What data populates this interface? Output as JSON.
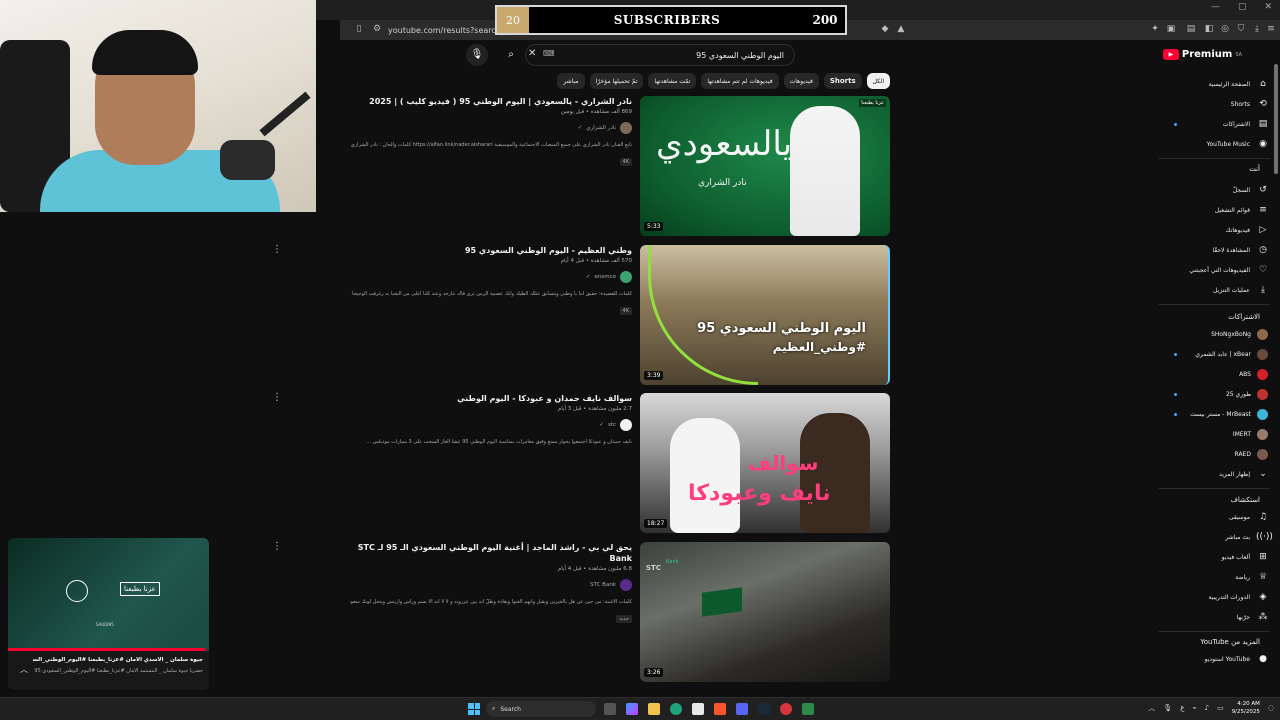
{
  "browser": {
    "url": "youtube.com/results?search_query=اليوم+الوطني+السعودي+95"
  },
  "overlay": {
    "current": "20",
    "title": "SUBSCRIBERS",
    "goal": "200"
  },
  "search": {
    "query": "اليوم الوطني السعودي 95"
  },
  "chips": [
    {
      "label": "الكل",
      "active": true
    },
    {
      "label": "Shorts",
      "active": false
    },
    {
      "label": "فيديوهات",
      "active": false
    },
    {
      "label": "فيديوهات لم تتم مشاهدتها",
      "active": false
    },
    {
      "label": "تمّت مشاهدتها",
      "active": false
    },
    {
      "label": "تمّ تحميلها مؤخرًا",
      "active": false
    },
    {
      "label": "مباشر",
      "active": false
    }
  ],
  "results": [
    {
      "title": "نادر الشراري - يالسعودي | اليوم الوطني 95 ( فيديو كليب ) | 2025",
      "meta": "869 ألف مشاهدة • قبل يومين",
      "channel": "نادر الشراري",
      "desc": "تابع الفنان نادر الشراري على جميع المنصات الاجتماعية والموسيقية https://alfan.link/nader.alsharari كلمات والحان : نادر الشراري ...",
      "badge": "4K",
      "duration": "5:33",
      "thumb_big": "يالسعودي",
      "thumb_small": "نادر الشراري",
      "thumb_tag": "عزنا بطبعنا"
    },
    {
      "title": "وطني العظيم - اليوم الوطني السعودي 95",
      "meta": "570 ألف مشاهدة • قبل 4 أيام",
      "channel": "ensmco",
      "desc": "كلمات للقصيدة: حقيق أننا يا وطني ويتسابق عثلك الطيك وأنك عصبية الزمن ترى فاك تتأرجد وعند كلنا أعلى من النجيا به رغرفت الوجيحا واضحا أصدحه ...",
      "badge": "4K",
      "duration": "3:39",
      "thumb_cap1": "اليوم الوطني السعودي 95",
      "thumb_cap2": "#وطني_العظيم"
    },
    {
      "title": "سوالف نايف حمدان و عبودكا - اليوم الوطني",
      "meta": "2.7 مليون مشاهدة • قبل 3 أيام",
      "channel": "stc",
      "desc": "نايف حمدان و عبودكا اجتمعوا بحوار ممتع وفيق مغامرات بمناسبة اليوم الوطني 95 عشا الغاز السحب على 3 سيارات موديلس ...",
      "badge": "",
      "duration": "18:27",
      "thumb_cap1": "سوالف",
      "thumb_cap2": "نايف وعبودكا"
    },
    {
      "title": "يحق لي بي - راشد الماجد | أغنية اليوم الوطني السعودي الـ 95 لـ STC Bank",
      "meta": "6.8 مليون مشاهدة • قبل 4 أيام",
      "channel": "STC Bank",
      "desc": "كلمات الأغنية: من حين عن هل بالخيرين ويقبل وأنهم الغنوا ويقادة وطلّ انه بين عزرونه و لا لا انه الا بسم وراس وارينس وينحل لونك سعودي الله الغنيا ...",
      "badge": "جديد",
      "duration": "3:26",
      "thumb_logo": "STC",
      "thumb_logo2": "Bank"
    }
  ],
  "sidebar": {
    "logo_word": "Premium",
    "logo_cc": "SA",
    "main": [
      {
        "label": "الصفحة الرئيسية",
        "icon": "⌂"
      },
      {
        "label": "Shorts",
        "icon": "⟲"
      },
      {
        "label": "الاشتراكات",
        "icon": "▤",
        "dot": true
      },
      {
        "label": "YouTube Music",
        "icon": "◉"
      }
    ],
    "you_header": "أنت",
    "you": [
      {
        "label": "السجلّ",
        "icon": "↺"
      },
      {
        "label": "قوائم التشغيل",
        "icon": "≡"
      },
      {
        "label": "فيديوهاتك",
        "icon": "▷"
      },
      {
        "label": "المشاهدة لاحقًا",
        "icon": "◷"
      },
      {
        "label": "الفيديوهات التي أعجبتني",
        "icon": "♡"
      },
      {
        "label": "عمليات التنزيل",
        "icon": "⤓"
      }
    ],
    "subs_header": "الاشتراكات",
    "subs": [
      {
        "label": "SHoNgxBoNg",
        "color": "#8a6a4a"
      },
      {
        "label": "xBear | عابد الشمري",
        "color": "#6a4a3a",
        "dot": true
      },
      {
        "label": "ABS",
        "color": "#d4202a"
      },
      {
        "label": "طوري 25",
        "color": "#b33",
        "dot": true
      },
      {
        "label": "MrBeast - مستر بيست",
        "color": "#3db4d8",
        "dot": true
      },
      {
        "label": "IMERT",
        "color": "#9a7a6a"
      },
      {
        "label": "RAED",
        "color": "#7a5a4a"
      }
    ],
    "show_more": "إظهار المزيد",
    "explore_header": "استكشاف",
    "explore": [
      {
        "label": "موسيقى",
        "icon": "♫"
      },
      {
        "label": "بث مباشر",
        "icon": "((·))"
      },
      {
        "label": "ألعاب فيديو",
        "icon": "⊞"
      },
      {
        "label": "رياضة",
        "icon": "♕"
      },
      {
        "label": "الدورات التدريبية",
        "icon": "◈"
      },
      {
        "label": "جرّبها",
        "icon": "⁂"
      }
    ],
    "more_header": "المزيد من YouTube",
    "more": [
      {
        "label": "YouTube استوديو",
        "icon": "●"
      }
    ]
  },
  "miniplayer": {
    "progress": 0.98,
    "logo": "عزنا بطبعنا",
    "sub": "SAUDI95",
    "title": "جيوة سلمان _ الأسدي الأمان #عزنا_بطبعنا #اليوم_الوطني_السعود...",
    "desc": "حصرياً جيوة سلمان _ المستمد الأمان #عزنا_بطبعنا #اليوم_الوطني_السعودي 95"
  },
  "taskbar": {
    "search_label": "Search",
    "time": "4:20 AM",
    "date": "9/25/2025",
    "lang": "ع"
  },
  "colors": {
    "accent_red": "#ff0033",
    "bg": "#0f0f0f",
    "link_blue": "#3ea6ff"
  }
}
